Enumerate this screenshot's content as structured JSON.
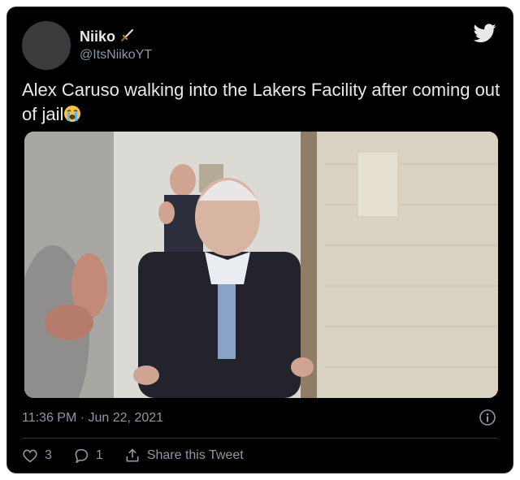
{
  "user": {
    "name": "Niiko",
    "handle": "@ItsNiikoYT"
  },
  "tweet": {
    "text": "Alex Caruso walking into the Lakers Facility after coming out of jail",
    "emoji_icon": "crying-face-emoji"
  },
  "media": {
    "type": "video-still",
    "icon": "video-frame"
  },
  "meta": {
    "timestamp": "11:36 PM · Jun 22, 2021"
  },
  "actions": {
    "likes": "3",
    "replies": "1",
    "share_label": "Share this Tweet"
  },
  "colors": {
    "background": "#000000",
    "text": "#e7e9ea",
    "muted": "#8b98a5",
    "border": "#2f3336"
  }
}
